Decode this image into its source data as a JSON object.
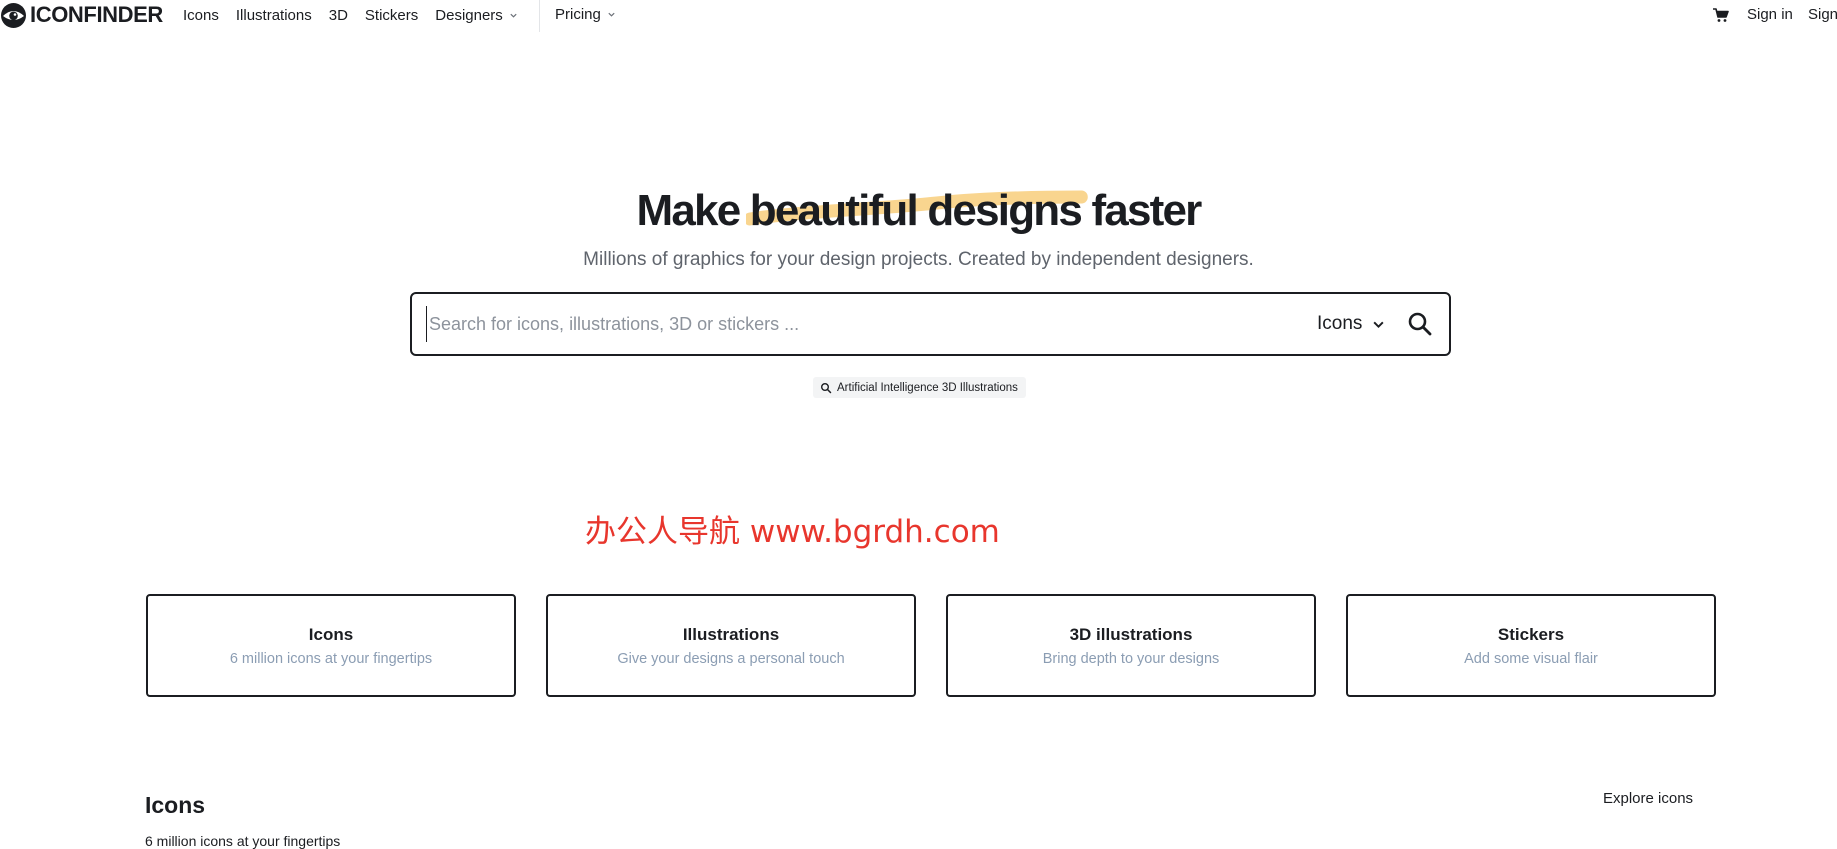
{
  "header": {
    "logo_text": "ICONFINDER",
    "nav": [
      {
        "label": "Icons"
      },
      {
        "label": "Illustrations"
      },
      {
        "label": "3D"
      },
      {
        "label": "Stickers"
      },
      {
        "label": "Designers",
        "has_dropdown": true
      }
    ],
    "pricing_label": "Pricing",
    "cart_icon": "cart-icon",
    "signin_label": "Sign in",
    "signup_label": "Sign"
  },
  "hero": {
    "title_before": "Make ",
    "title_highlight": "beautiful designs",
    "title_after": " faster",
    "subtitle": "Millions of graphics for your design projects. Created by independent designers.",
    "highlight_color": "#f9d58f"
  },
  "search": {
    "placeholder": "Search for icons, illustrations, 3D or stickers ...",
    "value": "",
    "type_selected": "Icons",
    "suggestion": "Artificial Intelligence 3D Illustrations"
  },
  "watermark": "办公人导航 www.bgrdh.com",
  "categories": [
    {
      "title": "Icons",
      "description": "6 million icons at your fingertips"
    },
    {
      "title": "Illustrations",
      "description": "Give your designs a personal touch"
    },
    {
      "title": "3D illustrations",
      "description": "Bring depth to your designs"
    },
    {
      "title": "Stickers",
      "description": "Add some visual flair"
    }
  ],
  "icons_section": {
    "title": "Icons",
    "subtitle": "6 million icons at your fingertips",
    "explore_label": "Explore icons"
  },
  "colors": {
    "text": "#1b1d21",
    "muted": "#5f646c",
    "card_desc": "#8b9db3",
    "watermark": "#e8362d"
  }
}
